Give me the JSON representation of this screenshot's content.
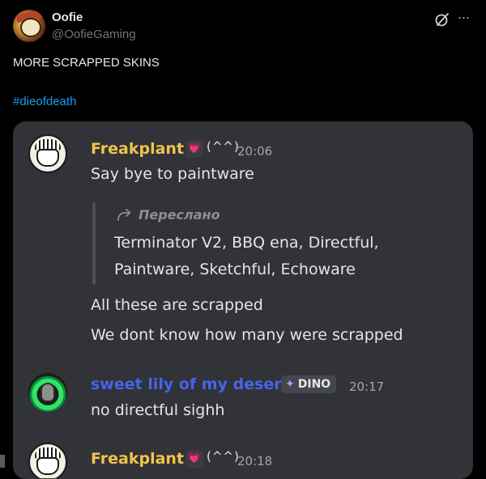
{
  "tweet": {
    "display_name": "Oofie",
    "handle": "@OofieGaming",
    "text": "MORE SCRAPPED SKINS",
    "hashtag": "#dieofdeath",
    "more_label": "···"
  },
  "media": {
    "messages": [
      {
        "author": "Freakplant",
        "time": "20:06",
        "lines": [
          "Say bye to paintware"
        ],
        "forward": {
          "label": "Переслано",
          "lines": [
            "Terminator V2, BBQ ena, Directful,",
            "Paintware, Sketchful, Echoware"
          ]
        },
        "after_lines": [
          "All these are scrapped",
          "We dont know how many were scrapped"
        ]
      },
      {
        "author": "sweet lily of my desert",
        "tag": "DINO",
        "time": "20:17",
        "lines": [
          "no directful sighh"
        ]
      },
      {
        "author": "Freakplant",
        "time": "20:18"
      }
    ],
    "badge_heart": "💗",
    "badge_cat": "(^^)"
  },
  "colors": {
    "background": "#000000",
    "hashtag": "#1d9bf0",
    "discord_bg": "#323339",
    "name_yellow": "#f0c54a",
    "name_blue": "#4565e8"
  }
}
